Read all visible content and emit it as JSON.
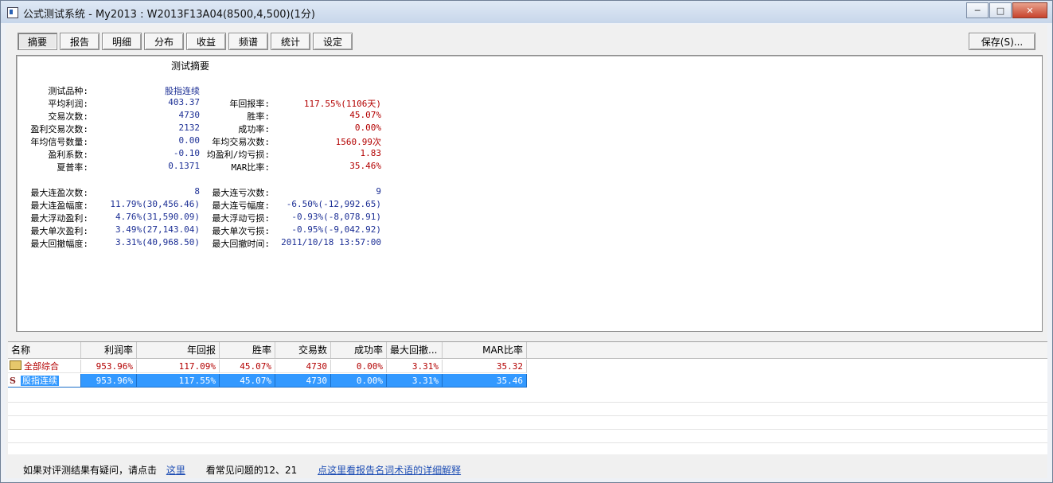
{
  "window": {
    "title": "公式测试系统 - My2013 : W2013F13A04(8500,4,500)(1分)",
    "btn_min": "─",
    "btn_max": "□",
    "btn_close": "✕"
  },
  "tabs": [
    "摘要",
    "报告",
    "明细",
    "分布",
    "收益",
    "频谱",
    "统计",
    "设定"
  ],
  "save_label": "保存(S)...",
  "summary": {
    "heading": "测试摘要",
    "block1": [
      {
        "l1": "测试品种:",
        "v1": "股指连续",
        "l2": "",
        "v2": ""
      },
      {
        "l1": "平均利润:",
        "v1": "403.37",
        "l2": "年回报率:",
        "v2": "117.55%(1106天)"
      },
      {
        "l1": "交易次数:",
        "v1": "4730",
        "l2": "胜率:",
        "v2": "45.07%"
      },
      {
        "l1": "盈利交易次数:",
        "v1": "2132",
        "l2": "成功率:",
        "v2": "0.00%"
      },
      {
        "l1": "年均信号数量:",
        "v1": "0.00",
        "l2": "年均交易次数:",
        "v2": "1560.99次"
      },
      {
        "l1": "盈利系数:",
        "v1": "-0.10",
        "l2": "均盈利/均亏损:",
        "v2": "1.83"
      },
      {
        "l1": "夏普率:",
        "v1": "0.1371",
        "l2": "MAR比率:",
        "v2": "35.46%"
      }
    ],
    "block2": [
      {
        "l1": "最大连盈次数:",
        "v1": "8",
        "l2": "最大连亏次数:",
        "v2": "9"
      },
      {
        "l1": "最大连盈幅度:",
        "v1": "11.79%(30,456.46)",
        "l2": "最大连亏幅度:",
        "v2": "-6.50%(-12,992.65)"
      },
      {
        "l1": "最大浮动盈利:",
        "v1": "4.76%(31,590.09)",
        "l2": "最大浮动亏损:",
        "v2": "-0.93%(-8,078.91)"
      },
      {
        "l1": "最大单次盈利:",
        "v1": "3.49%(27,143.04)",
        "l2": "最大单次亏损:",
        "v2": "-0.95%(-9,042.92)"
      },
      {
        "l1": "最大回撤幅度:",
        "v1": "3.31%(40,968.50)",
        "l2": "最大回撤时间:",
        "v2": "2011/10/18 13:57:00"
      }
    ]
  },
  "grid": {
    "headers": [
      "名称",
      "利润率",
      "年回报",
      "胜率",
      "交易数",
      "成功率",
      "最大回撤...",
      "MAR比率"
    ],
    "rows": [
      {
        "name": "全部综合",
        "profit": "953.96%",
        "annual": "117.09%",
        "win": "45.07%",
        "trades": "4730",
        "success": "0.00%",
        "drawdown": "3.31%",
        "mar": "35.32"
      },
      {
        "name": "股指连续",
        "profit": "953.96%",
        "annual": "117.55%",
        "win": "45.07%",
        "trades": "4730",
        "success": "0.00%",
        "drawdown": "3.31%",
        "mar": "35.46"
      }
    ]
  },
  "footer": {
    "prefix": "如果对评测结果有疑问，请点击",
    "link1": "这里",
    "middle": "看常见问题的12、21",
    "link2": "点这里看报告名词术语的详细解释"
  }
}
